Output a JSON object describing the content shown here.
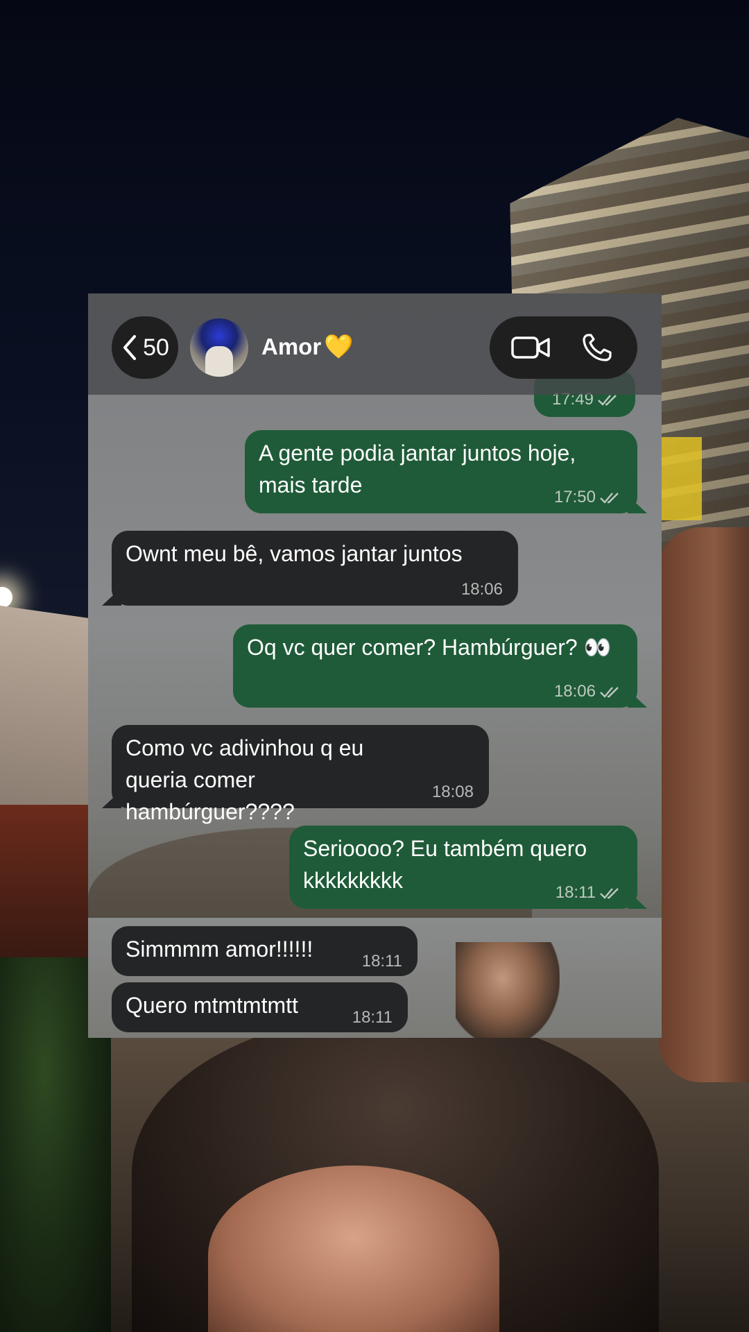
{
  "header": {
    "back_count": "50",
    "contact_name": "Amor",
    "contact_emoji": "💛"
  },
  "icons": {
    "back": "chevron-left-icon",
    "video_call": "video-camera-icon",
    "voice_call": "phone-icon",
    "read_receipt": "double-check-icon"
  },
  "colors": {
    "outgoing_bubble": "#1f5b38",
    "incoming_bubble": "#242526",
    "header_pill": "#1f1f20"
  },
  "messages": [
    {
      "direction": "out",
      "text": "",
      "time": "17:49",
      "read": true
    },
    {
      "direction": "out",
      "text": "A gente podia jantar juntos hoje, mais tarde",
      "time": "17:50",
      "read": true
    },
    {
      "direction": "in",
      "text": "Ownt meu bê, vamos jantar juntos",
      "time": "18:06"
    },
    {
      "direction": "out",
      "text": "Oq vc quer comer? Hambúrguer? 👀",
      "time": "18:06",
      "read": true
    },
    {
      "direction": "in",
      "text": "Como vc adivinhou q eu queria comer hambúrguer????",
      "time": "18:08"
    },
    {
      "direction": "out",
      "text": "Serioooo? Eu também quero kkkkkkkkk",
      "time": "18:11",
      "read": true
    },
    {
      "direction": "in",
      "text": "Simmmm amor!!!!!!",
      "time": "18:11"
    },
    {
      "direction": "in",
      "text": "Quero mtmtmtmtt",
      "time": "18:11"
    }
  ]
}
